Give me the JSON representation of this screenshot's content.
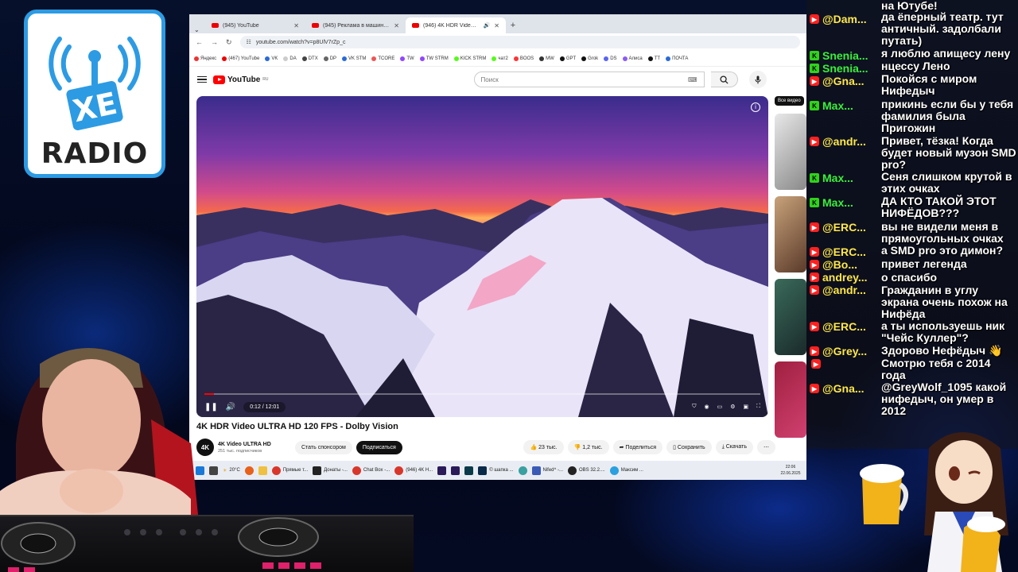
{
  "logo": {
    "text": "XE",
    "label": "RADIO"
  },
  "browser": {
    "tabs": [
      {
        "title": "(945) YouTube",
        "active": false
      },
      {
        "title": "(945) Реклама в машинах: будь",
        "active": false
      },
      {
        "title": "(946) 4K HDR Video ULTRA",
        "active": true
      }
    ],
    "url": "youtube.com/watch?v=p8UlV7rZp_c",
    "bookmarks": [
      "Яндекс",
      "(467) YouTube",
      "VK",
      "DA",
      "DTX",
      "DP",
      "VK STM",
      "TCORE",
      "TW",
      "TW STRM",
      "KICK STRM",
      "чат2",
      "BOOS",
      "MW",
      "GPT",
      "Grok",
      "DS",
      "Алиса",
      "TT",
      "ПОЧТА"
    ]
  },
  "youtube": {
    "brand": "YouTube",
    "region": "RU",
    "search_placeholder": "Поиск",
    "video_time": "0:12 / 12:01",
    "progress": 0.017,
    "video_title": "4K HDR Video ULTRA HD 120 FPS - Dolby Vision",
    "channel_name": "4K Video ULTRA HD",
    "channel_avatar": "4K",
    "subscribers": "251 тыс. подписчиков",
    "sponsor_label": "Стать спонсором",
    "subscribe_label": "Подписаться",
    "likes": "23 тыс.",
    "dislikes": "1,2 тыс.",
    "share_label": "Поделиться",
    "save_label": "Сохранить",
    "download_label": "Скачать",
    "sidebar_chip": "Все видео"
  },
  "taskbar": {
    "items": [
      "Прямые т...",
      "Донаты -...",
      "Chat Box -...",
      "(946) 4K H...",
      "© шапка ...",
      "Nifed^ -...",
      "OBS 32.2....",
      "Максим ..."
    ],
    "weather": "20°C",
    "time": "22:06",
    "date": "22.06.2025"
  },
  "chat": {
    "messages": [
      {
        "platform": "",
        "user": "",
        "text": "на Ютубе!"
      },
      {
        "platform": "youtube",
        "user": "@Dam...",
        "text": "да ёперный театр. тут античный. задолбали путать)"
      },
      {
        "platform": "kick",
        "user": "Snenia...",
        "text": "я люблю апищесу лену"
      },
      {
        "platform": "kick",
        "user": "Snenia...",
        "text": "нцессу Лено"
      },
      {
        "platform": "youtube",
        "user": "@Gna...",
        "text": "Покойся с миром Нифедыч"
      },
      {
        "platform": "kick",
        "user": "Max...",
        "text": "прикинь если бы у тебя фамилия была Пригожин"
      },
      {
        "platform": "youtube",
        "user": "@andr...",
        "text": "Привет, тёзка! Когда будет новый музон SMD pro?"
      },
      {
        "platform": "kick",
        "user": "Max...",
        "text": "Сеня слишком крутой в этих очках"
      },
      {
        "platform": "kick",
        "user": "Max...",
        "text": "ДА КТО ТАКОЙ ЭТОТ НИФЁДОВ???"
      },
      {
        "platform": "youtube",
        "user": "@ERC...",
        "text": "вы не видели меня в прямоугольных очках"
      },
      {
        "platform": "youtube",
        "user": "@ERC...",
        "text": "а SMD pro это димон?"
      },
      {
        "platform": "youtube",
        "user": "@Bo...",
        "text": "привет легенда"
      },
      {
        "platform": "youtube",
        "user": "andrey...",
        "text": "о спасибо"
      },
      {
        "platform": "youtube",
        "user": "@andr...",
        "text": "Гражданин в углу экрана очень похож на Нифёда"
      },
      {
        "platform": "youtube",
        "user": "@ERC...",
        "text": "а ты используешь ник \"Чейс Куллер\"?"
      },
      {
        "platform": "youtube",
        "user": "@Grey...",
        "text": "Здорово Нефёдыч 👋"
      },
      {
        "platform": "youtube",
        "user": "",
        "text": "Смотрю тебя с 2014 года"
      },
      {
        "platform": "youtube",
        "user": "@Gna...",
        "text": "@GreyWolf_1095 какой нифедыч, он умер в 2012"
      }
    ]
  }
}
